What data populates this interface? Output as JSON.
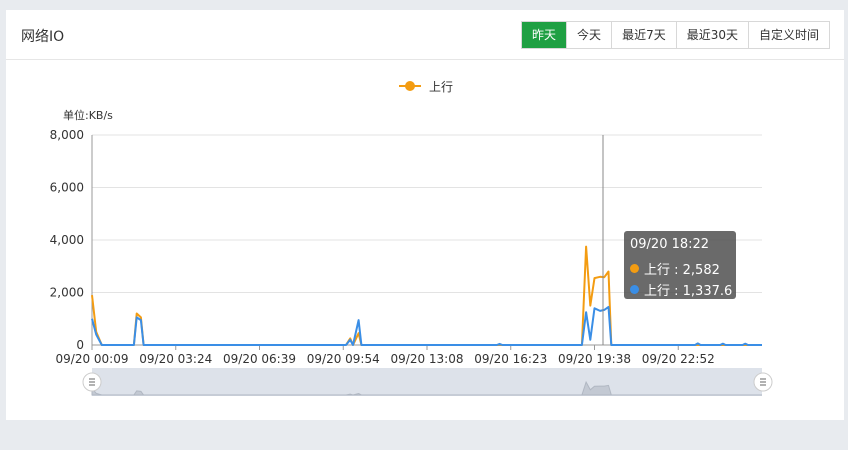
{
  "panel": {
    "title": "网络IO",
    "buttons": [
      {
        "label": "昨天",
        "active": true
      },
      {
        "label": "今天",
        "active": false
      },
      {
        "label": "最近7天",
        "active": false
      },
      {
        "label": "最近30天",
        "active": false
      },
      {
        "label": "自定义时间",
        "active": false
      }
    ]
  },
  "colors": {
    "orange": "#f39c12",
    "blue": "#3a8ee6",
    "active_button": "#1fa043"
  },
  "chart_data": {
    "type": "line",
    "legend": [
      "上行"
    ],
    "unit_label": "单位:KB/s",
    "ylim": [
      0,
      8000
    ],
    "y_ticks": [
      "0",
      "2,000",
      "4,000",
      "6,000",
      "8,000"
    ],
    "x_ticks": [
      "09/20 00:09",
      "09/20 03:24",
      "09/20 06:39",
      "09/20 09:54",
      "09/20 13:08",
      "09/20 16:23",
      "09/20 19:38",
      "09/20 22:52"
    ],
    "series": [
      {
        "name": "上行",
        "color": "#f39c12",
        "points": [
          [
            0,
            1900
          ],
          [
            0.15,
            500
          ],
          [
            0.35,
            0
          ],
          [
            1.5,
            0
          ],
          [
            1.6,
            1200
          ],
          [
            1.75,
            1050
          ],
          [
            1.85,
            0
          ],
          [
            9.1,
            0
          ],
          [
            9.25,
            250
          ],
          [
            9.35,
            0
          ],
          [
            9.55,
            450
          ],
          [
            9.65,
            0
          ],
          [
            17.55,
            0
          ],
          [
            17.7,
            3750
          ],
          [
            17.85,
            1500
          ],
          [
            18.0,
            2550
          ],
          [
            18.2,
            2600
          ],
          [
            18.35,
            2582
          ],
          [
            18.5,
            2800
          ],
          [
            18.6,
            0
          ],
          [
            23.9,
            0
          ],
          [
            24,
            0
          ]
        ]
      },
      {
        "name": "",
        "color": "#3a8ee6",
        "points": [
          [
            0,
            1000
          ],
          [
            0.15,
            400
          ],
          [
            0.35,
            0
          ],
          [
            1.5,
            0
          ],
          [
            1.6,
            1050
          ],
          [
            1.75,
            950
          ],
          [
            1.85,
            0
          ],
          [
            9.1,
            0
          ],
          [
            9.25,
            200
          ],
          [
            9.35,
            0
          ],
          [
            9.55,
            950
          ],
          [
            9.65,
            0
          ],
          [
            14.5,
            0
          ],
          [
            14.6,
            40
          ],
          [
            14.7,
            0
          ],
          [
            17.55,
            0
          ],
          [
            17.7,
            1250
          ],
          [
            17.85,
            200
          ],
          [
            18.0,
            1400
          ],
          [
            18.2,
            1300
          ],
          [
            18.35,
            1337.6
          ],
          [
            18.5,
            1450
          ],
          [
            18.6,
            0
          ],
          [
            21.6,
            0
          ],
          [
            21.7,
            60
          ],
          [
            21.8,
            0
          ],
          [
            22.5,
            0
          ],
          [
            22.6,
            50
          ],
          [
            22.7,
            0
          ],
          [
            23.3,
            0
          ],
          [
            23.4,
            50
          ],
          [
            23.5,
            0
          ],
          [
            24,
            0
          ]
        ]
      }
    ],
    "tooltip": {
      "title": "09/20 18:22",
      "rows": [
        {
          "label": "上行 : 2,582",
          "color": "#f39c12"
        },
        {
          "label": "上行 : 1,337.6",
          "color": "#3a8ee6"
        }
      ]
    }
  }
}
